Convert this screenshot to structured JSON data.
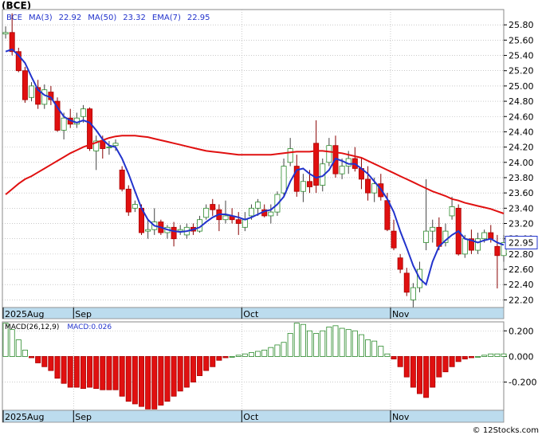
{
  "title": "(BCE)",
  "watermark": "© 12Stocks.com",
  "colors": {
    "up": "#2a8a2a",
    "down": "#e01010",
    "ma3": "#e01010",
    "ma50": "#2233cc",
    "axisband": "#bcdcee",
    "grid": "#aaaaaa",
    "hist_up": "#2a8a2a",
    "hist_down": "#e01010"
  },
  "legend": [
    {
      "label": "BCE",
      "color": "#2233cc"
    },
    {
      "label": "MA(3)",
      "color": "#2233cc"
    },
    {
      "label": "22.92",
      "color": "#2233cc"
    },
    {
      "label": "MA(50)",
      "color": "#2233cc"
    },
    {
      "label": "23.32",
      "color": "#2233cc"
    },
    {
      "label": "EMA(7)",
      "color": "#2233cc"
    },
    {
      "label": "22.95",
      "color": "#2233cc"
    }
  ],
  "macd_legend": [
    {
      "label": "MACD(26,12,9)",
      "color": "#000000"
    },
    {
      "label": "MACD:0.026",
      "color": "#2233cc"
    }
  ],
  "last_price_label": "22.95",
  "x_axis_labels": [
    "2025Aug",
    "Sep",
    "Oct",
    "Nov"
  ],
  "chart_data": [
    {
      "type": "candlestick",
      "ylim": [
        22.1,
        26.0
      ],
      "yticks": [
        22.2,
        22.4,
        22.6,
        22.8,
        23.0,
        23.2,
        23.4,
        23.6,
        23.8,
        24.0,
        24.2,
        24.4,
        24.6,
        24.8,
        25.0,
        25.2,
        25.4,
        25.6,
        25.8
      ],
      "ytick_labels": [
        "22.20",
        "22.40",
        "22.60",
        "22.80",
        "23.00",
        "23.20",
        "23.40",
        "23.60",
        "23.80",
        "24.00",
        "24.20",
        "24.40",
        "24.60",
        "24.80",
        "25.00",
        "25.20",
        "25.40",
        "25.60",
        "25.80"
      ],
      "grid": true,
      "month_starts": [
        {
          "label": "Sep",
          "index": 11
        },
        {
          "label": "Oct",
          "index": 37
        },
        {
          "label": "Nov",
          "index": 60
        }
      ],
      "candles": [
        [
          25.68,
          25.78,
          25.62,
          25.7
        ],
        [
          25.7,
          25.95,
          25.4,
          25.45
        ],
        [
          25.45,
          25.5,
          25.18,
          25.2
        ],
        [
          25.2,
          25.25,
          24.78,
          24.82
        ],
        [
          24.85,
          25.05,
          24.8,
          25.0
        ],
        [
          24.98,
          25.08,
          24.7,
          24.76
        ],
        [
          24.76,
          25.02,
          24.7,
          24.95
        ],
        [
          24.92,
          25.0,
          24.75,
          24.82
        ],
        [
          24.8,
          24.85,
          24.4,
          24.42
        ],
        [
          24.42,
          24.65,
          24.3,
          24.58
        ],
        [
          24.58,
          24.7,
          24.45,
          24.5
        ],
        [
          24.5,
          24.65,
          24.45,
          24.58
        ],
        [
          24.6,
          24.75,
          24.52,
          24.7
        ],
        [
          24.7,
          24.72,
          24.15,
          24.18
        ],
        [
          24.15,
          24.35,
          23.9,
          24.28
        ],
        [
          24.28,
          24.35,
          24.05,
          24.18
        ],
        [
          24.2,
          24.28,
          24.1,
          24.2
        ],
        [
          24.22,
          24.3,
          24.15,
          24.25
        ],
        [
          23.9,
          23.95,
          23.62,
          23.65
        ],
        [
          23.65,
          23.7,
          23.3,
          23.35
        ],
        [
          23.4,
          23.5,
          23.35,
          23.45
        ],
        [
          23.4,
          23.45,
          23.05,
          23.08
        ],
        [
          23.1,
          23.25,
          23.0,
          23.12
        ],
        [
          23.12,
          23.4,
          23.05,
          23.22
        ],
        [
          23.22,
          23.25,
          23.05,
          23.08
        ],
        [
          23.08,
          23.18,
          23.0,
          23.15
        ],
        [
          23.15,
          23.22,
          22.9,
          23.0
        ],
        [
          23.1,
          23.18,
          23.05,
          23.12
        ],
        [
          23.05,
          23.2,
          23.0,
          23.15
        ],
        [
          23.15,
          23.2,
          23.05,
          23.1
        ],
        [
          23.1,
          23.3,
          23.08,
          23.25
        ],
        [
          23.28,
          23.45,
          23.25,
          23.4
        ],
        [
          23.45,
          23.52,
          23.3,
          23.38
        ],
        [
          23.38,
          23.45,
          23.1,
          23.25
        ],
        [
          23.25,
          23.5,
          23.2,
          23.3
        ],
        [
          23.3,
          23.4,
          23.2,
          23.25
        ],
        [
          23.25,
          23.35,
          23.05,
          23.2
        ],
        [
          23.15,
          23.35,
          23.1,
          23.25
        ],
        [
          23.3,
          23.45,
          23.25,
          23.4
        ],
        [
          23.4,
          23.52,
          23.3,
          23.48
        ],
        [
          23.38,
          23.45,
          23.28,
          23.3
        ],
        [
          23.3,
          23.45,
          23.2,
          23.35
        ],
        [
          23.35,
          23.62,
          23.3,
          23.58
        ],
        [
          23.6,
          24.05,
          23.55,
          23.95
        ],
        [
          24.0,
          24.32,
          23.95,
          24.18
        ],
        [
          23.95,
          24.1,
          23.55,
          23.62
        ],
        [
          23.62,
          23.85,
          23.48,
          23.75
        ],
        [
          23.75,
          23.9,
          23.6,
          23.68
        ],
        [
          24.25,
          24.55,
          23.6,
          23.7
        ],
        [
          23.7,
          24.05,
          23.62,
          23.98
        ],
        [
          24.0,
          24.32,
          23.95,
          24.22
        ],
        [
          24.22,
          24.35,
          23.8,
          23.85
        ],
        [
          23.85,
          24.05,
          23.78,
          23.95
        ],
        [
          23.95,
          24.15,
          23.85,
          24.05
        ],
        [
          24.05,
          24.2,
          23.88,
          23.92
        ],
        [
          23.92,
          24.05,
          23.65,
          23.78
        ],
        [
          23.78,
          23.95,
          23.5,
          23.6
        ],
        [
          23.6,
          23.8,
          23.48,
          23.72
        ],
        [
          23.72,
          23.85,
          23.5,
          23.55
        ],
        [
          23.5,
          23.6,
          23.1,
          23.12
        ],
        [
          23.1,
          23.25,
          22.85,
          22.88
        ],
        [
          22.75,
          22.8,
          22.55,
          22.6
        ],
        [
          22.55,
          22.62,
          22.25,
          22.3
        ],
        [
          22.2,
          22.42,
          22.1,
          22.36
        ],
        [
          22.36,
          22.7,
          22.3,
          22.6
        ],
        [
          22.95,
          23.78,
          22.85,
          23.1
        ],
        [
          23.1,
          23.25,
          22.95,
          23.15
        ],
        [
          23.15,
          23.28,
          22.85,
          22.9
        ],
        [
          22.95,
          23.2,
          22.9,
          23.1
        ],
        [
          23.3,
          23.55,
          23.25,
          23.42
        ],
        [
          23.4,
          23.45,
          22.78,
          22.8
        ],
        [
          22.8,
          23.05,
          22.75,
          23.0
        ],
        [
          23.0,
          23.12,
          22.8,
          22.85
        ],
        [
          22.85,
          23.08,
          22.8,
          23.0
        ],
        [
          23.0,
          23.12,
          22.95,
          23.08
        ],
        [
          23.08,
          23.18,
          22.95,
          23.0
        ],
        [
          22.9,
          23.05,
          22.35,
          22.78
        ],
        [
          22.78,
          23.05,
          22.7,
          22.95
        ]
      ],
      "ma_short": [
        25.45,
        25.48,
        25.4,
        25.3,
        25.12,
        24.95,
        24.88,
        24.85,
        24.72,
        24.6,
        24.55,
        24.52,
        24.55,
        24.52,
        24.42,
        24.3,
        24.22,
        24.2,
        24.05,
        23.85,
        23.62,
        23.4,
        23.25,
        23.17,
        23.15,
        23.12,
        23.1,
        23.09,
        23.1,
        23.12,
        23.15,
        23.22,
        23.28,
        23.32,
        23.32,
        23.3,
        23.28,
        23.25,
        23.28,
        23.32,
        23.36,
        23.38,
        23.45,
        23.55,
        23.75,
        23.9,
        23.92,
        23.85,
        23.8,
        23.82,
        23.9,
        24.05,
        24.02,
        23.98,
        23.98,
        23.92,
        23.85,
        23.75,
        23.65,
        23.52,
        23.35,
        23.1,
        22.88,
        22.65,
        22.48,
        22.4,
        22.7,
        22.9,
        22.98,
        23.05,
        23.1,
        23.0,
        22.98,
        22.95,
        22.98,
        23.0,
        22.95,
        22.92
      ],
      "ma_long": [
        23.58,
        23.65,
        23.72,
        23.78,
        23.82,
        23.87,
        23.92,
        23.97,
        24.02,
        24.07,
        24.12,
        24.16,
        24.2,
        24.23,
        24.26,
        24.29,
        24.32,
        24.34,
        24.35,
        24.35,
        24.35,
        24.34,
        24.33,
        24.31,
        24.29,
        24.27,
        24.25,
        24.23,
        24.21,
        24.19,
        24.17,
        24.15,
        24.14,
        24.13,
        24.12,
        24.11,
        24.1,
        24.1,
        24.1,
        24.1,
        24.1,
        24.1,
        24.11,
        24.12,
        24.13,
        24.14,
        24.14,
        24.14,
        24.15,
        24.15,
        24.14,
        24.13,
        24.12,
        24.1,
        24.08,
        24.06,
        24.02,
        23.98,
        23.94,
        23.9,
        23.86,
        23.82,
        23.78,
        23.74,
        23.7,
        23.66,
        23.62,
        23.59,
        23.56,
        23.52,
        23.5,
        23.47,
        23.45,
        23.43,
        23.41,
        23.39,
        23.36,
        23.33
      ]
    },
    {
      "type": "bar",
      "title": "MACD(26,12,9)",
      "ylim": [
        -0.42,
        0.27
      ],
      "yticks": [
        0.2,
        0.0,
        -0.2
      ],
      "ytick_labels": [
        "0.200",
        "0.000",
        "-0.200"
      ],
      "values": [
        0.26,
        0.21,
        0.13,
        0.05,
        -0.01,
        -0.05,
        -0.08,
        -0.11,
        -0.17,
        -0.21,
        -0.24,
        -0.24,
        -0.25,
        -0.24,
        -0.25,
        -0.26,
        -0.26,
        -0.26,
        -0.31,
        -0.35,
        -0.37,
        -0.39,
        -0.41,
        -0.41,
        -0.38,
        -0.35,
        -0.31,
        -0.27,
        -0.24,
        -0.2,
        -0.15,
        -0.11,
        -0.08,
        -0.03,
        -0.01,
        0.0,
        0.01,
        0.02,
        0.03,
        0.04,
        0.05,
        0.07,
        0.09,
        0.11,
        0.18,
        0.26,
        0.25,
        0.2,
        0.18,
        0.2,
        0.23,
        0.24,
        0.22,
        0.21,
        0.2,
        0.17,
        0.13,
        0.12,
        0.08,
        0.02,
        -0.02,
        -0.08,
        -0.16,
        -0.24,
        -0.29,
        -0.32,
        -0.24,
        -0.16,
        -0.12,
        -0.08,
        -0.04,
        -0.02,
        -0.01,
        0.0,
        0.01,
        0.02,
        0.02,
        0.02
      ]
    }
  ]
}
